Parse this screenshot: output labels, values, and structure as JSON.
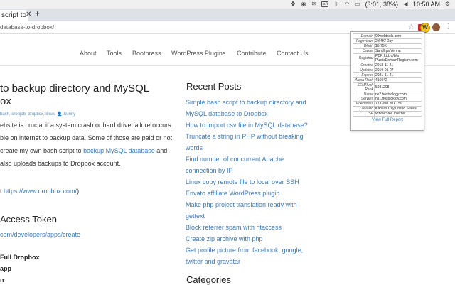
{
  "os": {
    "battery": "(3:01, 38%)",
    "clock": "10:50 AM",
    "keyboard_layout": "En"
  },
  "browser": {
    "tab_title": "script to",
    "url": "database-to-dropbox/",
    "new_tab": "+",
    "extension_letter": "W"
  },
  "nav": [
    "About",
    "Tools",
    "Bootpress",
    "WordPress Plugins",
    "Contribute",
    "Contact Us"
  ],
  "article": {
    "title_line1": "to backup directory and MySQL",
    "title_line2": "ox",
    "meta_tags": "bash, cronjob, dropbox, linux",
    "meta_author": "Sunny",
    "p1_l1": "ebsite is crucial if a system crash or hard drive failure occurs.",
    "p1_l2": "ble on internet to backup data. Some of those are paid or not",
    "p1_l3a": "create my own bash script to ",
    "p1_l3_link": "backup MySQL database",
    "p1_l3b": " and",
    "p1_l4": "also uploads backups to Dropbox account.",
    "p2_pre": "t ",
    "p2_link": "https://www.dropbox.com/",
    "p2_post": ")",
    "h2": "Access Token",
    "h2_link": "com/developers/apps/create",
    "b1": "Full Dropbox",
    "b2": "app",
    "b3": "n"
  },
  "sidebar": {
    "recent_heading": "Recent Posts",
    "recent": [
      "Simple bash script to backup directory and",
      "MySQL database to Dropbox",
      "How to import csv file in MySQL database?",
      "Truncate a string in PHP without breaking",
      "words",
      "Find number of concurrent Apache",
      "connection by IP",
      "Linux copy remote file to local over SSH",
      "Envato affiliate WordPress plugin",
      "Make php project translation ready with",
      "gettext",
      "Block referrer spam with htaccess",
      "Create zip archive with php",
      "Get profile picture from facebook, google,",
      "twitter and gravatar"
    ],
    "categories_heading": "Categories"
  },
  "popup": {
    "rows": [
      {
        "k": "Domain",
        "v": "99webtools.com"
      },
      {
        "k": "Pageviews",
        "v": "2.64K/ Day"
      },
      {
        "k": "Worth",
        "v": "$5.75K"
      },
      {
        "k": "Owner",
        "v": "Sandhya Verma"
      },
      {
        "k": "Registrar",
        "v": "PDR Ltd. d/b/a PublicDomainRegistry.com"
      },
      {
        "k": "Created",
        "v": "2013-11-21"
      },
      {
        "k": "Updated",
        "v": "2019-05-27"
      },
      {
        "k": "Expires",
        "v": "2021-11-21"
      },
      {
        "k": "Alexa Rank",
        "v": "416042"
      },
      {
        "k": "SEMRush Rank",
        "v": "5931208"
      },
      {
        "k": "Name Servers",
        "v": "ns2.hostsology.com ns1.hostsology.com"
      },
      {
        "k": "IP Address",
        "v": "173.208.201.150"
      },
      {
        "k": "Location",
        "v": "Kansas City,United States"
      },
      {
        "k": "ISP",
        "v": "WholeSale Internet"
      }
    ],
    "footer": "View Full Report"
  }
}
